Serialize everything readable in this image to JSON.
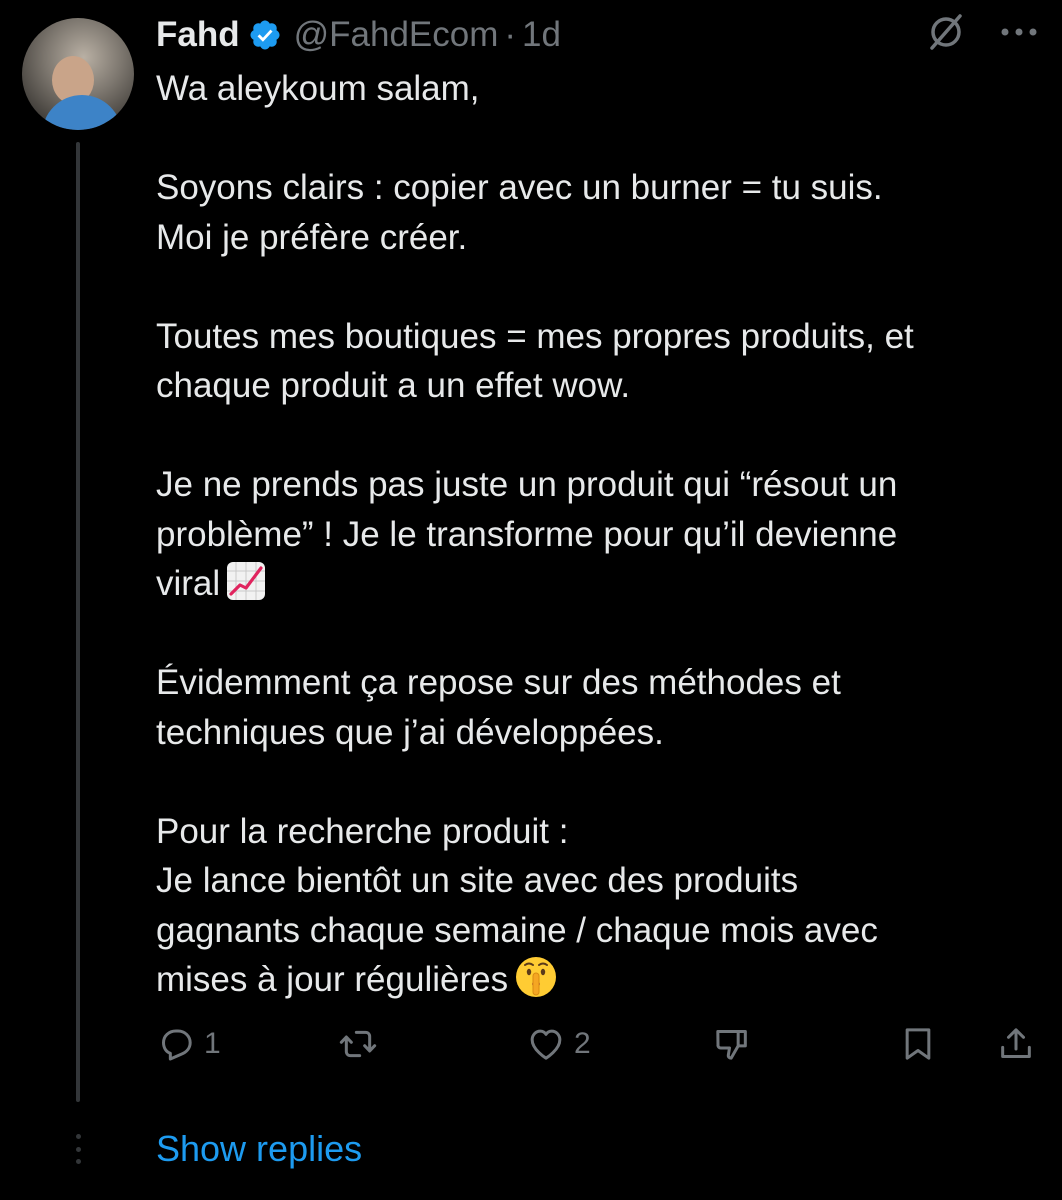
{
  "tweet": {
    "author_name": "Fahd",
    "handle": "@FahdEcom",
    "separator": "·",
    "time": "1d",
    "lines": [
      [
        "Wa aleykoum salam,"
      ],
      [
        "Soyons clairs : copier avec un burner = tu suis.",
        "Moi je préfère créer."
      ],
      [
        "Toutes mes boutiques = mes propres produits, et",
        "chaque produit a un effet wow."
      ],
      [
        "Je ne prends pas juste un produit qui “résout un",
        "problème” ! Je le transforme pour qu’il devienne",
        "viral"
      ],
      [
        "Évidemment ça repose sur des méthodes et",
        "techniques que j’ai développées."
      ],
      [
        "Pour la recherche produit :",
        "Je lance bientôt un site avec des produits",
        "gagnants chaque semaine / chaque mois avec",
        "mises à jour régulières"
      ]
    ],
    "p1": "Wa aleykoum salam,",
    "p2_l1": "Soyons clairs : copier avec un burner = tu suis.",
    "p2_l2": "Moi je préfère créer.",
    "p3_l1": "Toutes mes boutiques = mes propres produits, et",
    "p3_l2": "chaque produit a un effet wow.",
    "p4_l1": "Je ne prends pas juste un produit qui “résout un",
    "p4_l2": "problème” ! Je le transforme pour qu’il devienne",
    "p4_l3": "viral",
    "p5_l1": "Évidemment ça repose sur des méthodes et",
    "p5_l2": "techniques que j’ai développées.",
    "p6_l1": "Pour la recherche produit :",
    "p6_l2": "Je lance bientôt un site avec des produits",
    "p6_l3": "gagnants chaque semaine / chaque mois avec",
    "p6_l4": "mises à jour régulières",
    "emojis": [
      "chart-increasing",
      "shushing-face"
    ]
  },
  "actions": {
    "reply_count": "1",
    "like_count": "2"
  },
  "footer": {
    "show_replies": "Show replies"
  },
  "colors": {
    "background": "#000000",
    "text": "#e7e9ea",
    "muted": "#71767b",
    "accent": "#1d9bf0",
    "verified": "#1d9bf0"
  },
  "icons": [
    "verified-badge-icon",
    "grok-icon",
    "more-icon",
    "reply-icon",
    "retweet-icon",
    "like-icon",
    "dislike-icon",
    "bookmark-icon",
    "share-icon"
  ]
}
